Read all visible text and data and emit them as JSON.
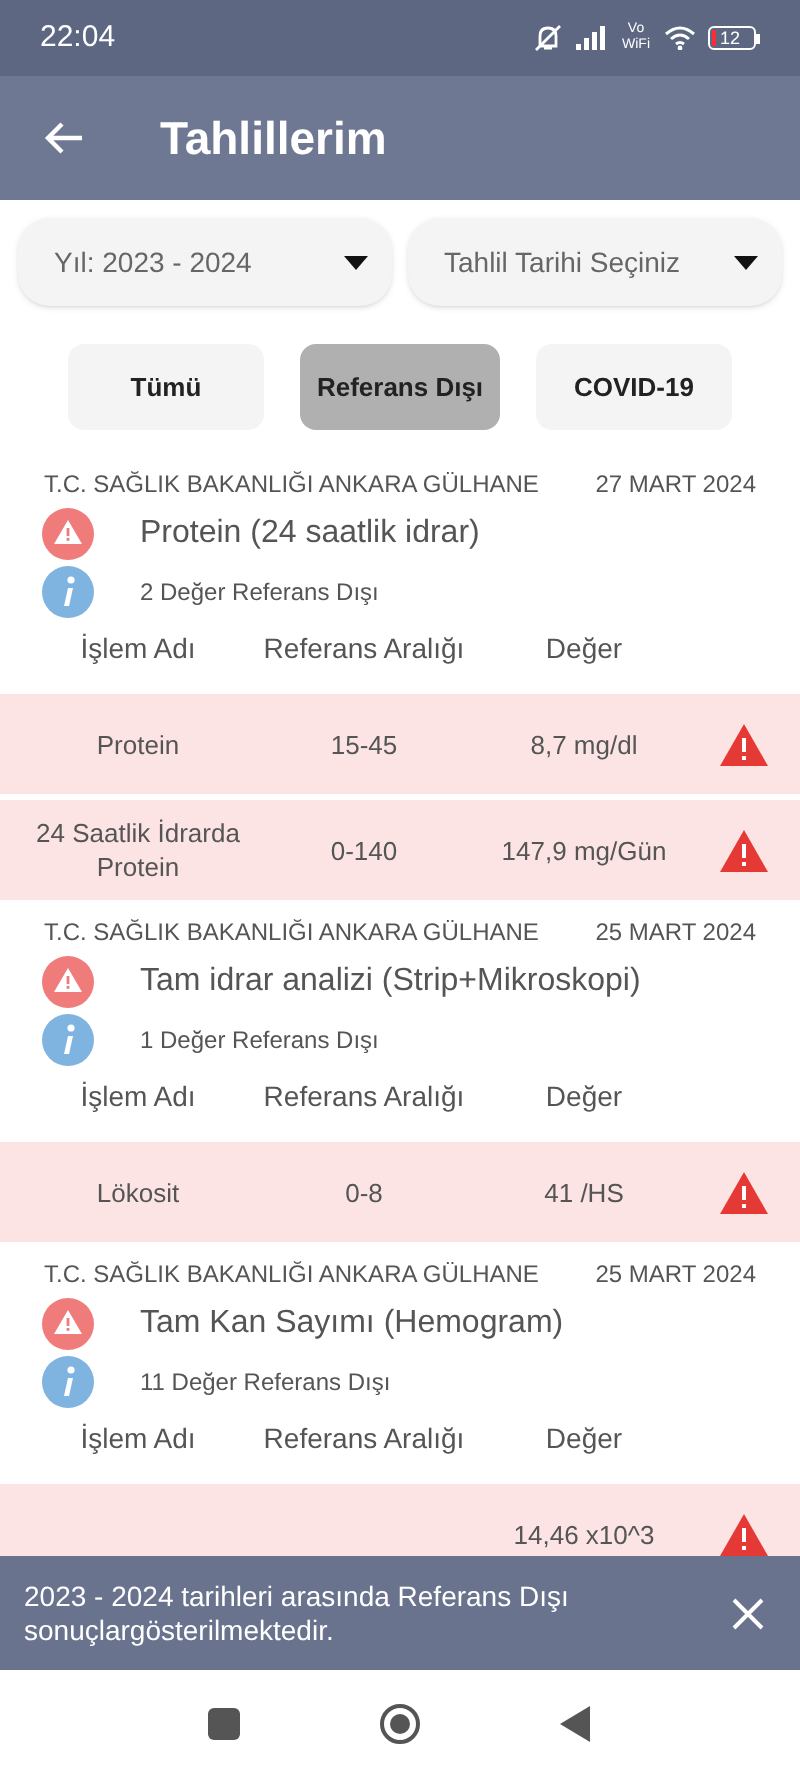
{
  "status_bar": {
    "time": "22:04",
    "network_label": "Vo WiFi",
    "battery": "12"
  },
  "app_bar": {
    "title": "Tahlillerim"
  },
  "filters": [
    {
      "value": "Yıl: 2023 - 2024"
    },
    {
      "value": "Tahlil Tarihi Seçiniz"
    }
  ],
  "tabs": [
    {
      "label": "Tümü",
      "selected": false
    },
    {
      "label": "Referans Dışı",
      "selected": true
    },
    {
      "label": "COVID-19",
      "selected": false
    }
  ],
  "results": [
    {
      "institution": "T.C. SAĞLIK BAKANLIĞI ANKARA GÜLHANE",
      "date": "27 MART 2024",
      "test": "Protein (24 saatlik idrar)",
      "summary": "2 Değer Referans Dışı",
      "columns": [
        "İşlem Adı",
        "Referans Aralığı",
        "Değer"
      ],
      "rows": [
        {
          "name": "Protein",
          "range": "15-45",
          "value": "8,7 mg/dl",
          "out_of_range": true
        },
        {
          "name": "24 Saatlik İdrarda Protein",
          "range": "0-140",
          "value": "147,9 mg/Gün",
          "out_of_range": true
        }
      ]
    },
    {
      "institution": "T.C. SAĞLIK BAKANLIĞI ANKARA GÜLHANE",
      "date": "25 MART 2024",
      "test": "Tam idrar analizi (Strip+Mikroskopi)",
      "summary": "1 Değer Referans Dışı",
      "columns": [
        "İşlem Adı",
        "Referans Aralığı",
        "Değer"
      ],
      "rows": [
        {
          "name": "Lökosit",
          "range": "0-8",
          "value": "41 /HS",
          "out_of_range": true
        }
      ]
    },
    {
      "institution": "T.C. SAĞLIK BAKANLIĞI ANKARA GÜLHANE",
      "date": "25 MART 2024",
      "test": "Tam Kan Sayımı (Hemogram)",
      "summary": "11 Değer Referans Dışı",
      "columns": [
        "İşlem Adı",
        "Referans Aralığı",
        "Değer"
      ],
      "rows": [
        {
          "value": "14,46 x10^3",
          "out_of_range": true
        }
      ]
    }
  ],
  "snackbar": {
    "message": "2023 - 2024 tarihleri arasında Referans Dışı sonuçlargösterilmektedir."
  }
}
